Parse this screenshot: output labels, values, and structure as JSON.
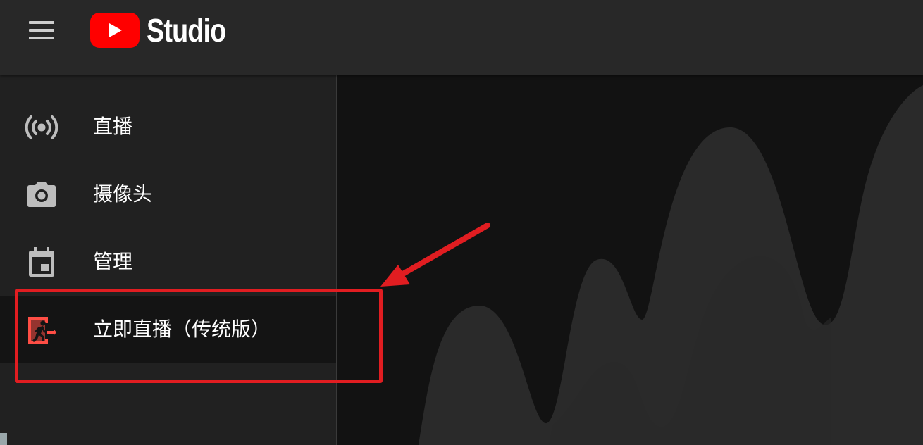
{
  "app": {
    "brand_name": "Studio",
    "logo_icon": "youtube-play-logo",
    "brand_color": "#ff0000"
  },
  "header": {
    "menu_icon": "hamburger-menu-icon"
  },
  "sidebar": {
    "items": [
      {
        "label": "直播",
        "icon": "broadcast-icon",
        "active": false
      },
      {
        "label": "摄像头",
        "icon": "camera-icon",
        "active": false
      },
      {
        "label": "管理",
        "icon": "calendar-icon",
        "active": false
      },
      {
        "label": "立即直播（传统版）",
        "icon": "exit-running-person-icon",
        "active": true
      }
    ]
  },
  "annotation": {
    "color": "#e11d21"
  },
  "colors": {
    "topbar": "#282828",
    "sidebar": "#212121",
    "active_item": "#141414",
    "canvas": "#121212",
    "wave": "#2a2a2a",
    "icon": "#bdbdbd",
    "active_icon": "#ff4e45"
  }
}
